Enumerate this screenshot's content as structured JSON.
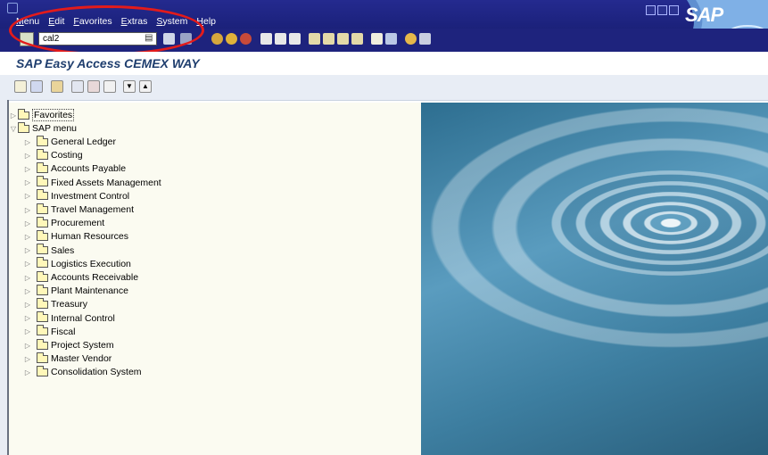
{
  "menubar": {
    "items": [
      "Menu",
      "Edit",
      "Favorites",
      "Extras",
      "System",
      "Help"
    ],
    "logo": "SAP"
  },
  "toolbar": {
    "command_field_value": "cal2"
  },
  "screen": {
    "title": "SAP Easy Access CEMEX WAY"
  },
  "tree": {
    "favorites_label": "Favorites",
    "root_label": "SAP menu",
    "items": [
      "General Ledger",
      "Costing",
      "Accounts Payable",
      "Fixed Assets Management",
      "Investment Control",
      "Travel Management",
      "Procurement",
      "Human Resources",
      "Sales",
      "Logistics Execution",
      "Accounts Receivable",
      "Plant Maintenance",
      "Treasury",
      "Internal Control",
      "Fiscal",
      "Project System",
      "Master Vendor",
      "Consolidation System"
    ]
  },
  "colors": {
    "menubar_bg": "#1b217a",
    "title_text": "#1f3e6e",
    "highlight_circle": "#e31b1b",
    "folder_fill": "#fff7b9"
  }
}
